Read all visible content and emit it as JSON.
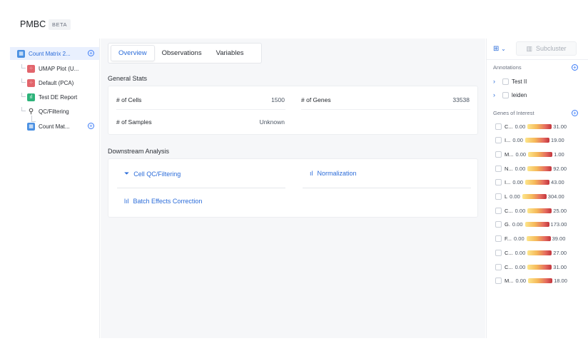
{
  "header": {
    "title": "PMBC",
    "badge": "BETA"
  },
  "sidebar": {
    "items": [
      {
        "label": "Count Matrix 2...",
        "icon": "matrix-icon",
        "selected": true
      },
      {
        "label": "UMAP Plot (U...",
        "icon": "scatter-plot-icon"
      },
      {
        "label": "Default (PCA)",
        "icon": "scatter-plot-icon"
      },
      {
        "label": "Test DE Report",
        "icon": "bar-chart-icon"
      },
      {
        "label": "QC/Filtering",
        "icon": "filter-icon"
      },
      {
        "label": "Count Mat...",
        "icon": "matrix-icon"
      }
    ]
  },
  "main": {
    "tabs": [
      {
        "label": "Overview",
        "active": true
      },
      {
        "label": "Observations"
      },
      {
        "label": "Variables"
      }
    ],
    "general_stats": {
      "title": "General Stats",
      "cells_label": "# of Cells",
      "cells_value": "1500",
      "genes_label": "# of Genes",
      "genes_value": "33538",
      "samples_label": "# of Samples",
      "samples_value": "Unknown"
    },
    "downstream": {
      "title": "Downstream Analysis",
      "cell_qc": "Cell QC/Filtering",
      "normalization": "Normalization",
      "batch": "Batch Effects Correction"
    }
  },
  "right_panel": {
    "subcluster_label": "Subcluster",
    "annotations_title": "Annotations",
    "annotations": [
      {
        "label": "Test II"
      },
      {
        "label": "leiden"
      }
    ],
    "genes_title": "Genes of Interest",
    "genes": [
      {
        "name": "C...",
        "min": "0.00",
        "max": "31.00"
      },
      {
        "name": "I...",
        "min": "0.00",
        "max": "19.00"
      },
      {
        "name": "M...",
        "min": "0.00",
        "max": "1.00"
      },
      {
        "name": "N...",
        "min": "0.00",
        "max": "92.00"
      },
      {
        "name": "I...",
        "min": "0.00",
        "max": "43.00"
      },
      {
        "name": "L",
        "min": "0.00",
        "max": "304.00"
      },
      {
        "name": "C...",
        "min": "0.00",
        "max": "25.00"
      },
      {
        "name": "G.",
        "min": "0.00",
        "max": "173.00"
      },
      {
        "name": "F...",
        "min": "0.00",
        "max": "39.00"
      },
      {
        "name": "C...",
        "min": "0.00",
        "max": "27.00"
      },
      {
        "name": "C...",
        "min": "0.00",
        "max": "31.00"
      },
      {
        "name": "M...",
        "min": "0.00",
        "max": "18.00"
      }
    ]
  },
  "colors": {
    "accent": "#2b6cd9",
    "selected_bg": "#e9f0fe",
    "panel_bg": "#f6f7f9"
  }
}
